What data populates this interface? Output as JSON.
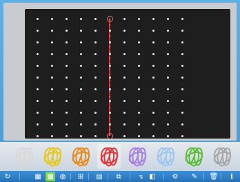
{
  "board": {
    "background": "#1e1e1e",
    "peg_color": "#e9e9e9",
    "columns": 11,
    "rows": 11,
    "stretched_band": {
      "color": "#e8262b",
      "from_peg": {
        "col": 5,
        "row": 0
      },
      "to_peg": {
        "col": 5,
        "row": 10
      }
    }
  },
  "bands": [
    {
      "name": "white-band",
      "color": "#d8d8d8",
      "selected": false
    },
    {
      "name": "yellow-band",
      "color": "#e7c81d",
      "selected": false
    },
    {
      "name": "orange-band",
      "color": "#e98a1d",
      "selected": false
    },
    {
      "name": "red-band",
      "color": "#e23636",
      "selected": true
    },
    {
      "name": "purple-band",
      "color": "#a880e0",
      "selected": false
    },
    {
      "name": "light-blue-band",
      "color": "#9ec6f0",
      "selected": false
    },
    {
      "name": "green-band",
      "color": "#5cbd3a",
      "selected": false
    },
    {
      "name": "gray-band",
      "color": "#a7a7a7",
      "selected": false
    }
  ],
  "toolbar": {
    "tools": [
      {
        "name": "reset-icon",
        "glyph": "↻"
      },
      {
        "name": "grid-small-icon",
        "glyph": "▦"
      },
      {
        "name": "grid-large-icon",
        "glyph": "▩"
      },
      {
        "name": "circle-board-icon",
        "glyph": "◍"
      },
      {
        "name": "table-icon",
        "glyph": "⊞"
      },
      {
        "name": "calendar-icon",
        "glyph": "▤"
      },
      {
        "name": "copy-icon",
        "glyph": "⧉"
      },
      {
        "name": "measure-icon",
        "glyph": "⦪"
      },
      {
        "name": "fill-icon",
        "glyph": "◧"
      },
      {
        "name": "settings-icon",
        "glyph": "⚙"
      },
      {
        "name": "pen-icon",
        "glyph": "✎"
      },
      {
        "name": "trash-icon",
        "glyph": "🗑"
      },
      {
        "name": "info-icon",
        "glyph": "ℹ"
      }
    ]
  }
}
